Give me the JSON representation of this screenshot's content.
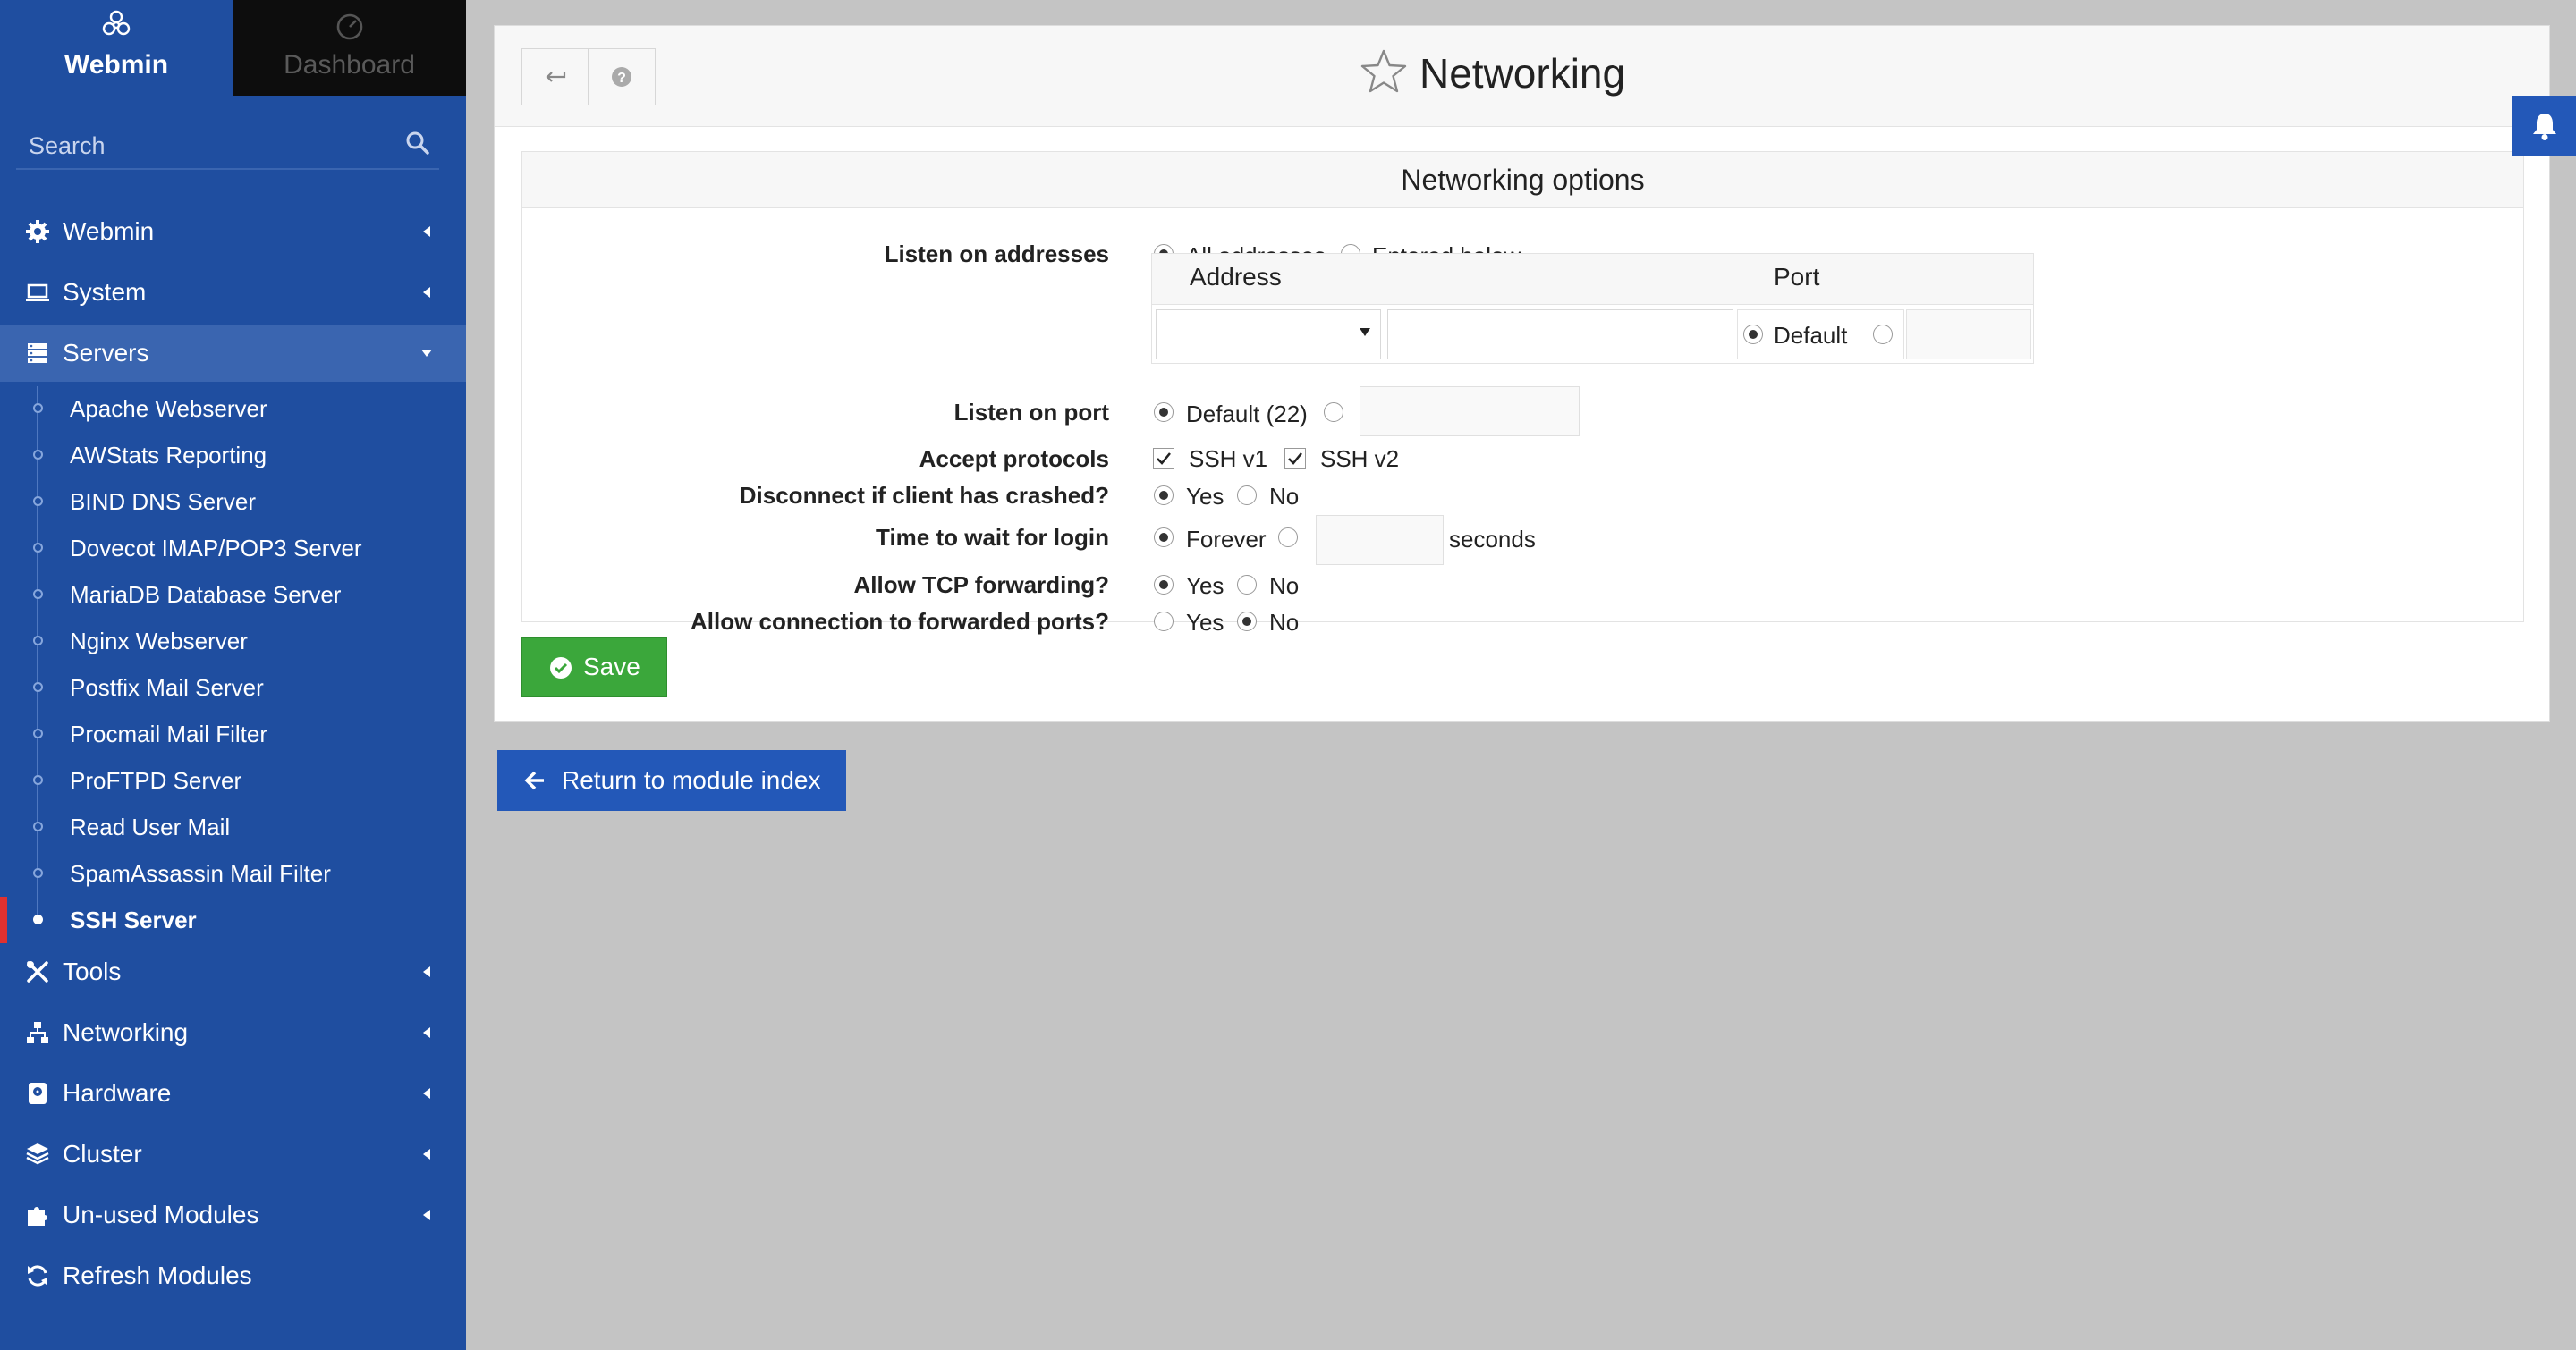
{
  "sidebar": {
    "tabs": {
      "webmin": "Webmin",
      "dashboard": "Dashboard"
    },
    "search": {
      "placeholder": "Search",
      "value": ""
    },
    "menu": {
      "webmin": "Webmin",
      "system": "System",
      "servers": "Servers",
      "tools": "Tools",
      "networking": "Networking",
      "hardware": "Hardware",
      "cluster": "Cluster",
      "unused": "Un-used Modules",
      "refresh": "Refresh Modules"
    },
    "servers_items": [
      "Apache Webserver",
      "AWStats Reporting",
      "BIND DNS Server",
      "Dovecot IMAP/POP3 Server",
      "MariaDB Database Server",
      "Nginx Webserver",
      "Postfix Mail Server",
      "Procmail Mail Filter",
      "ProFTPD Server",
      "Read User Mail",
      "SpamAssassin Mail Filter",
      "SSH Server"
    ]
  },
  "page": {
    "title": "Networking",
    "section_title": "Networking options",
    "listen_addresses": {
      "label": "Listen on addresses",
      "opt_all": "All addresses",
      "opt_below": "Entered below ..",
      "selected": "all",
      "table": {
        "col_address": "Address",
        "col_port": "Port",
        "port_default": "Default"
      }
    },
    "listen_port": {
      "label": "Listen on port",
      "opt_default": "Default (22)",
      "selected": "default"
    },
    "protocols": {
      "label": "Accept protocols",
      "v1": "SSH v1",
      "v2": "SSH v2",
      "v1_checked": true,
      "v2_checked": true
    },
    "disconnect": {
      "label": "Disconnect if client has crashed?",
      "yes": "Yes",
      "no": "No",
      "selected": "yes"
    },
    "login_wait": {
      "label": "Time to wait for login",
      "forever": "Forever",
      "unit": "seconds",
      "selected": "forever"
    },
    "tcp_forwarding": {
      "label": "Allow TCP forwarding?",
      "yes": "Yes",
      "no": "No",
      "selected": "yes"
    },
    "forwarded_ports": {
      "label": "Allow connection to forwarded ports?",
      "yes": "Yes",
      "no": "No",
      "selected": "no"
    },
    "save_label": "Save",
    "return_label": "Return to module index"
  },
  "colors": {
    "sidebar_bg": "#1f4ea0",
    "sidebar_active": "#3a65b0",
    "save_green": "#3ba73b",
    "return_blue": "#2358b8",
    "current_marker": "#e0312f"
  }
}
